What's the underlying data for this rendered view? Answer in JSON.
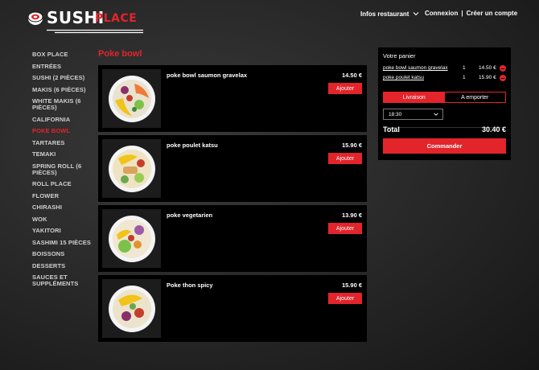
{
  "header": {
    "logo_sushi": "SUSHI",
    "logo_place": "PLACE",
    "infos_label": "Infos restaurant",
    "connexion_label": "Connexion",
    "separator": "|",
    "create_account_label": "Créer un compte"
  },
  "sidebar": {
    "items": [
      {
        "label": "BOX PLACE"
      },
      {
        "label": "ENTRÉES"
      },
      {
        "label": "SUSHI (2 PIÈCES)"
      },
      {
        "label": "MAKIS (6 PIÈCES)"
      },
      {
        "label": "WHITE MAKIS (6 PIÈCES)"
      },
      {
        "label": "CALIFORNIA"
      },
      {
        "label": "POKE BOWL"
      },
      {
        "label": "TARTARES"
      },
      {
        "label": "TEMAKI"
      },
      {
        "label": "SPRING ROLL (6 PIÈCES)"
      },
      {
        "label": "ROLL PLACE"
      },
      {
        "label": "FLOWER"
      },
      {
        "label": "CHIRASHI"
      },
      {
        "label": "WOK"
      },
      {
        "label": "YAKITORI"
      },
      {
        "label": "SASHIMI 15 PIÈCES"
      },
      {
        "label": "BOISSONS"
      },
      {
        "label": "DESSERTS"
      },
      {
        "label": "SAUCES ET SUPPLÉMENTS"
      }
    ],
    "active": "POKE BOWL"
  },
  "main": {
    "section_title": "Poke bowl",
    "items": [
      {
        "name": "poke bowl saumon gravelax",
        "price": "14.50 €",
        "add_label": "Ajouter"
      },
      {
        "name": "poke poulet katsu",
        "price": "15.90 €",
        "add_label": "Ajouter"
      },
      {
        "name": "poke vegetarien",
        "price": "13.90 €",
        "add_label": "Ajouter"
      },
      {
        "name": "Poke thon spicy",
        "price": "15.90 €",
        "add_label": "Ajouter"
      }
    ]
  },
  "cart": {
    "title": "Votre panier",
    "items": [
      {
        "name": "poke bowl saumon gravelax",
        "qty": "1",
        "price": "14.50 €"
      },
      {
        "name": "poke poulet katsu",
        "qty": "1",
        "price": "15.90 €"
      }
    ],
    "tabs": [
      {
        "label": "Livraison",
        "active": true
      },
      {
        "label": "A emporter",
        "active": false
      }
    ],
    "time": "18:30",
    "total_label": "Total",
    "total_value": "30.40 €",
    "order_label": "Commander"
  },
  "colors": {
    "accent": "#e3242b",
    "card_bg": "#000000",
    "text": "#ffffff"
  },
  "icons": {
    "logo": "sushi-roll-icon",
    "chevron": "chevron-down-icon",
    "remove": "minus-circle-icon"
  }
}
